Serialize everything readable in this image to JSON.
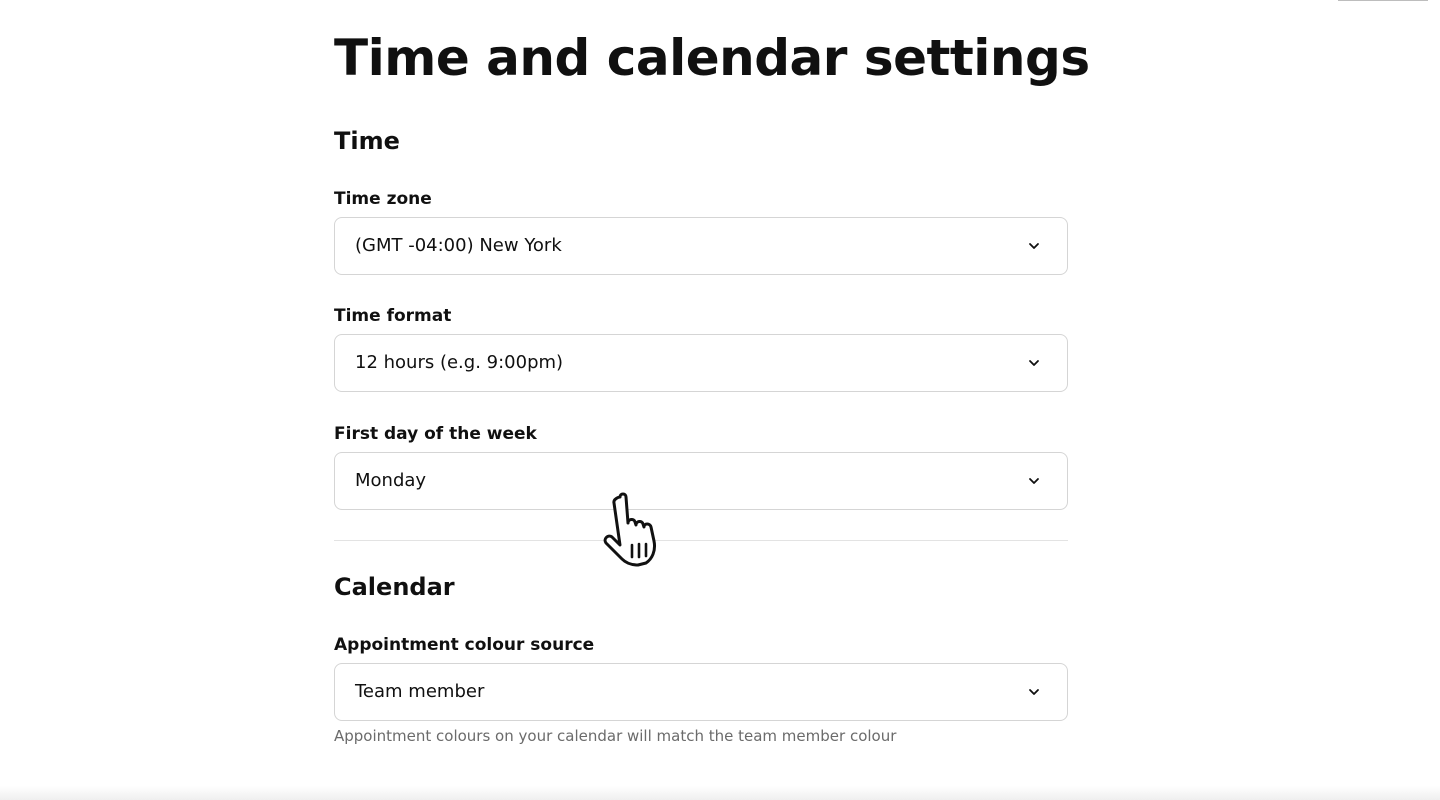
{
  "page": {
    "title": "Time and calendar settings"
  },
  "time_section": {
    "title": "Time",
    "time_zone": {
      "label": "Time zone",
      "value": "(GMT -04:00) New York"
    },
    "time_format": {
      "label": "Time format",
      "value": "12 hours (e.g. 9:00pm)"
    },
    "first_day": {
      "label": "First day of the week",
      "value": "Monday"
    }
  },
  "calendar_section": {
    "title": "Calendar",
    "colour_source": {
      "label": "Appointment colour source",
      "value": "Team member",
      "helper": "Appointment colours on your calendar will match the team member colour"
    }
  },
  "icons": {
    "select_chevron": "chevron-down-icon",
    "cursor": "hand-pointer-icon"
  },
  "colors": {
    "text": "#101010",
    "border": "#d5d5d5",
    "muted": "#6b6b6b",
    "divider": "#e3e3e3"
  }
}
